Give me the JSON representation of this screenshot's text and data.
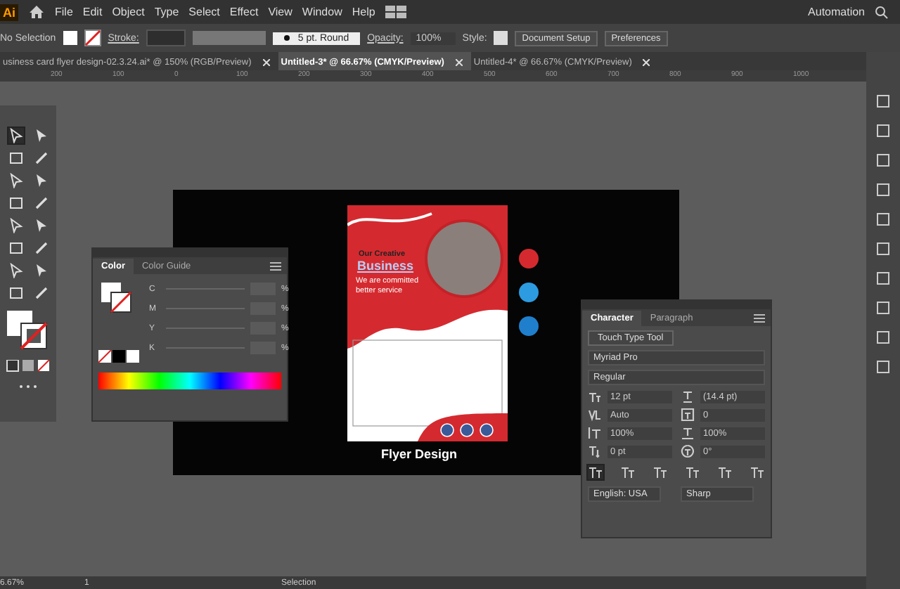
{
  "menu_bar": {
    "logo": "Ai",
    "items": [
      "File",
      "Edit",
      "Object",
      "Type",
      "Select",
      "Effect",
      "View",
      "Window",
      "Help"
    ],
    "workspace": "Automation"
  },
  "control_bar": {
    "selection": "No Selection",
    "stroke_label": "Stroke:",
    "brush": "5 pt. Round",
    "opacity_label": "Opacity:",
    "opacity": "100%",
    "style_label": "Style:",
    "buttons": [
      "Document Setup",
      "Preferences"
    ]
  },
  "tabs": [
    {
      "label": "usiness card flyer design-02.3.24.ai* @ 150% (RGB/Preview)",
      "selected": false
    },
    {
      "label": "Untitled-3* @ 66.67% (CMYK/Preview)",
      "selected": true
    },
    {
      "label": "Untitled-4* @ 66.67% (CMYK/Preview)",
      "selected": false
    }
  ],
  "ruler": [
    "200",
    "100",
    "0",
    "100",
    "200",
    "300",
    "400",
    "500",
    "600",
    "700",
    "800",
    "900",
    "1000"
  ],
  "color_panel": {
    "tabs": [
      {
        "label": "Color",
        "selected": true
      },
      {
        "label": "Color Guide",
        "selected": false
      }
    ],
    "channels": [
      {
        "label": "C",
        "unit": "%"
      },
      {
        "label": "M",
        "unit": "%"
      },
      {
        "label": "Y",
        "unit": "%"
      },
      {
        "label": "K",
        "unit": "%"
      }
    ]
  },
  "artboard": {
    "flyer": {
      "heading": "Our Creative",
      "title": "Business",
      "tagline": [
        "We are committed",
        "better service"
      ]
    },
    "caption": "Flyer Design",
    "swatches": [
      {
        "color": "#d42a2f"
      },
      {
        "color": "#2d9be0"
      },
      {
        "color": "#1f7fcc"
      }
    ]
  },
  "character_panel": {
    "tabs": [
      {
        "label": "Character",
        "selected": true
      },
      {
        "label": "Paragraph",
        "selected": false
      }
    ],
    "touch_type": "Touch Type Tool",
    "font": "Myriad Pro",
    "style": "Regular",
    "fields": [
      {
        "kind": "size",
        "value": "12 pt"
      },
      {
        "kind": "leading",
        "value": "(14.4 pt)"
      },
      {
        "kind": "kerning",
        "value": "Auto"
      },
      {
        "kind": "tracking",
        "value": "0"
      },
      {
        "kind": "vscale",
        "value": "100%"
      },
      {
        "kind": "hscale",
        "value": "100%"
      },
      {
        "kind": "baseline",
        "value": "0 pt"
      },
      {
        "kind": "rotation",
        "value": "0°"
      }
    ],
    "language": "English: USA",
    "antialias": "Sharp"
  },
  "status_bar": {
    "zoom": "6.67%",
    "page": "1",
    "tool": "Selection"
  }
}
